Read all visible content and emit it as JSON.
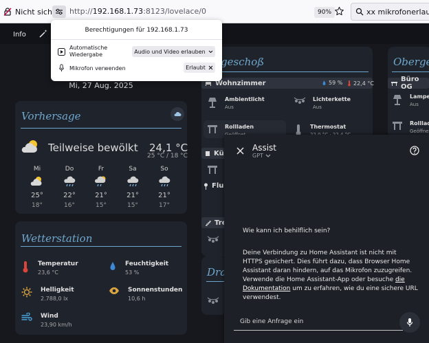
{
  "browser": {
    "site_label": "Nicht sicher",
    "url_prefix": "http://",
    "url_host": "192.168.1.73",
    "url_rest": ":8123/lovelace/0",
    "zoom": "90%",
    "search_text": "xx mikrofonerlaubnis fu"
  },
  "permissions_popup": {
    "title": "Berechtigungen für 192.168.1.73",
    "autoplay_label_1": "Automatische",
    "autoplay_label_2": "Wiedergabe",
    "autoplay_value": "Audio und Video erlauben",
    "mic_label": "Mikrofon verwenden",
    "mic_value": "Erlaubt"
  },
  "ha_header": {
    "tab_info": "Info"
  },
  "date": "Mi, 27 Aug. 2025",
  "forecast": {
    "title": "Vorhersage",
    "condition": "Teilweise bewölkt",
    "temp": "24,1 °C",
    "minmax": "25 °C / 18 °C",
    "days": [
      {
        "name": "Mi",
        "hi": "25°",
        "lo": "18°",
        "icon": "partly-cloudy-icon"
      },
      {
        "name": "Do",
        "hi": "22°",
        "lo": "16°",
        "icon": "rainy-icon"
      },
      {
        "name": "Fr",
        "hi": "21°",
        "lo": "15°",
        "icon": "partly-cloudy-rain-icon"
      },
      {
        "name": "Sa",
        "hi": "21°",
        "lo": "15°",
        "icon": "rainy-icon"
      },
      {
        "name": "So",
        "hi": "21°",
        "lo": "17°",
        "icon": "rainy-icon"
      }
    ]
  },
  "weather_station": {
    "title": "Wetterstation",
    "temperature": {
      "label": "Temperatur",
      "value": "23,6 °C"
    },
    "humidity": {
      "label": "Feuchtigkeit",
      "value": "53 %"
    },
    "brightness": {
      "label": "Helligkeit",
      "value": "2.788,0 lx"
    },
    "sunshine": {
      "label": "Sonnenstunden",
      "value": "10,6 h"
    },
    "wind": {
      "label": "Wind",
      "value": "23,90 km/h"
    }
  },
  "ground_floor": {
    "title_visible": "geschoß",
    "room": "Wohnzimmer",
    "humidity": "59 %",
    "temp": "22,4 °C",
    "ambient": {
      "label": "Ambientlicht",
      "state": "Aus"
    },
    "fairy": {
      "label": "Lichterkette",
      "state": "Aus"
    },
    "blinds": {
      "label": "Rollladen",
      "state": "Geöffnet"
    },
    "thermostat": {
      "label": "Thermostat",
      "state": "22,0 °C · 22,4 °C"
    },
    "kitchen_partial": "Küc",
    "hallway_partial": "Flur",
    "stairs_partial": "Tre"
  },
  "outdoor": {
    "title_partial": "Drau"
  },
  "upper_floor": {
    "title_visible": "Obergesc",
    "room": "Büro OG",
    "lamp": {
      "label": "Lampe",
      "state": "Aus"
    },
    "blinds": {
      "label": "Rolllad",
      "state": "Geöffne"
    }
  },
  "assist": {
    "title": "Assist",
    "subtitle": "GPT",
    "question": "Wie kann ich behilflich sein?",
    "message_pre": "Deine Verbindung zu Home Assistant ist nicht mit HTTPS gesichert. Dies führt dazu, dass Browser Home Assistant daran hindern, auf das Mikrofon zuzugreifen. Verwende die Home Assistant-App oder besuche ",
    "message_link": "die Dokumentation",
    "message_post": " um zu erfahren, wie du eine sichere URL verwendest.",
    "input_placeholder": "Gib eine Anfrage ein"
  }
}
